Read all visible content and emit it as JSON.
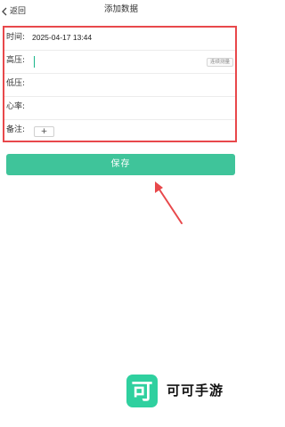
{
  "header": {
    "back_label": "返回",
    "back_icon": "chevron-left-icon",
    "title": "添加数据"
  },
  "form": {
    "time": {
      "label": "时间:",
      "value": "2025-04-17 13:44"
    },
    "systolic": {
      "label": "高压:",
      "value": "",
      "tag_label": "连续测量"
    },
    "diastolic": {
      "label": "低压:",
      "value": ""
    },
    "heart_rate": {
      "label": "心率:",
      "value": ""
    },
    "note": {
      "label": "备注:",
      "add_label": "+"
    }
  },
  "save_label": "保存",
  "annotation": {
    "arrow_color": "#e8484b",
    "highlight_color": "#e8484b"
  },
  "watermark": {
    "logo_text": "可",
    "brand": "可可手游"
  },
  "colors": {
    "accent": "#3fc49a",
    "logo": "#2fd09f",
    "cursor": "#19b58a"
  }
}
